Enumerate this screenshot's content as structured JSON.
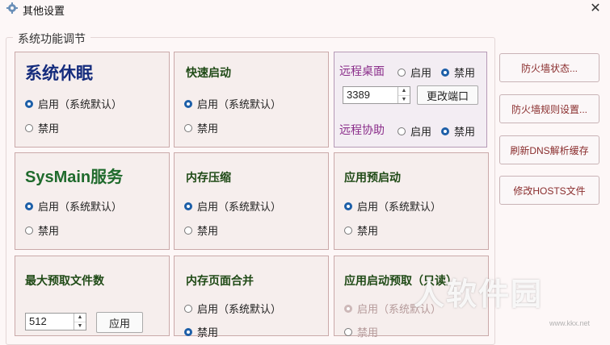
{
  "window": {
    "title": "其他设置",
    "close_label": "✕"
  },
  "group_title": "系统功能调节",
  "sleep": {
    "title": "系统休眠",
    "opt_enable": "启用（系统默认）",
    "opt_disable": "禁用",
    "selected": "enable"
  },
  "fast_startup": {
    "title": "快速启动",
    "opt_enable": "启用（系统默认）",
    "opt_disable": "禁用",
    "selected": "enable"
  },
  "remote": {
    "desktop_label": "远程桌面",
    "desktop_enable": "启用",
    "desktop_disable": "禁用",
    "desktop_selected": "disable",
    "port_value": "3389",
    "change_port_label": "更改端口",
    "assist_label": "远程协助",
    "assist_enable": "启用",
    "assist_disable": "禁用",
    "assist_selected": "disable"
  },
  "sysmain": {
    "title": "SysMain服务",
    "opt_enable": "启用（系统默认）",
    "opt_disable": "禁用",
    "selected": "enable"
  },
  "mem_compress": {
    "title": "内存压缩",
    "opt_enable": "启用（系统默认）",
    "opt_disable": "禁用",
    "selected": "enable"
  },
  "app_prelaunch": {
    "title": "应用预启动",
    "opt_enable": "启用（系统默认）",
    "opt_disable": "禁用",
    "selected": "enable"
  },
  "prefetch_max": {
    "title": "最大预取文件数",
    "value": "512",
    "apply_label": "应用"
  },
  "page_combine": {
    "title": "内存页面合并",
    "opt_enable": "启用（系统默认）",
    "opt_disable": "禁用",
    "selected": "disable"
  },
  "app_launch_prefetch": {
    "title": "应用启动预取（只读）",
    "opt_enable": "启用（系统默认）",
    "opt_disable": "禁用",
    "selected": "enable"
  },
  "sidebar": {
    "firewall_status": "防火墙状态...",
    "firewall_rules": "防火墙规则设置...",
    "flush_dns": "刷新DNS解析缓存",
    "edit_hosts": "修改HOSTS文件"
  },
  "watermark": {
    "text": "软件园",
    "sub": "www.kkx.net"
  }
}
